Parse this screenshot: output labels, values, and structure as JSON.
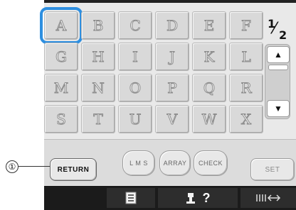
{
  "keyboard": {
    "rows": [
      [
        "A",
        "B",
        "C",
        "D",
        "E",
        "F"
      ],
      [
        "G",
        "H",
        "I",
        "J",
        "K",
        "L"
      ],
      [
        "M",
        "N",
        "O",
        "P",
        "Q",
        "R"
      ],
      [
        "S",
        "T",
        "U",
        "V",
        "W",
        "X"
      ]
    ],
    "selected": "A"
  },
  "page_indicator": {
    "current": "1",
    "total": "2"
  },
  "scroll": {
    "up_icon": "▲",
    "down_icon": "▼"
  },
  "buttons": {
    "return": "RETURN",
    "lms": "L M S",
    "array": "ARRAY",
    "check": "CHECK",
    "set": "SET"
  },
  "bottom_bar": {
    "list_icon": "list-icon",
    "machine_help_icon": "machine-help-icon",
    "help_mark": "?",
    "thread_icon": "thread-icon"
  },
  "callout": {
    "label": "①"
  },
  "colors": {
    "selection": "#2e8fe0"
  }
}
